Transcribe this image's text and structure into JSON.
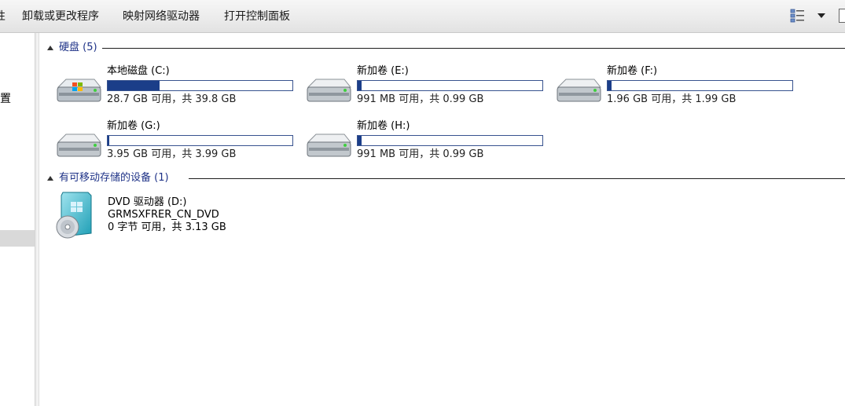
{
  "toolbar": {
    "partial_item": "性",
    "uninstall": "卸载或更改程序",
    "map_drive": "映射网络驱动器",
    "control_panel": "打开控制面板"
  },
  "nav": {
    "partial_label": "置"
  },
  "groups": {
    "hdd": {
      "title": "硬盘 (5)"
    },
    "removable": {
      "title": "有可移动存储的设备 (1)"
    }
  },
  "drives": [
    {
      "name": "本地磁盘 (C:)",
      "free": "28.7 GB 可用，共 39.8 GB",
      "used_percent": 28,
      "icon": "system-drive-icon"
    },
    {
      "name": "新加卷 (E:)",
      "free": "991 MB 可用，共 0.99 GB",
      "used_percent": 2,
      "icon": "drive-icon"
    },
    {
      "name": "新加卷 (F:)",
      "free": "1.96 GB 可用，共 1.99 GB",
      "used_percent": 2,
      "icon": "drive-icon"
    },
    {
      "name": "新加卷 (G:)",
      "free": "3.95 GB 可用，共 3.99 GB",
      "used_percent": 1,
      "icon": "drive-icon"
    },
    {
      "name": "新加卷 (H:)",
      "free": "991 MB 可用，共 0.99 GB",
      "used_percent": 2,
      "icon": "drive-icon"
    }
  ],
  "dvd": {
    "name": "DVD 驱动器 (D:)",
    "label": "GRMSXFRER_CN_DVD",
    "free": "0 字节 可用，共 3.13 GB",
    "icon": "dvd-icon"
  },
  "colors": {
    "bar_fill": "#1b3e89",
    "group_title": "#1e3287"
  }
}
